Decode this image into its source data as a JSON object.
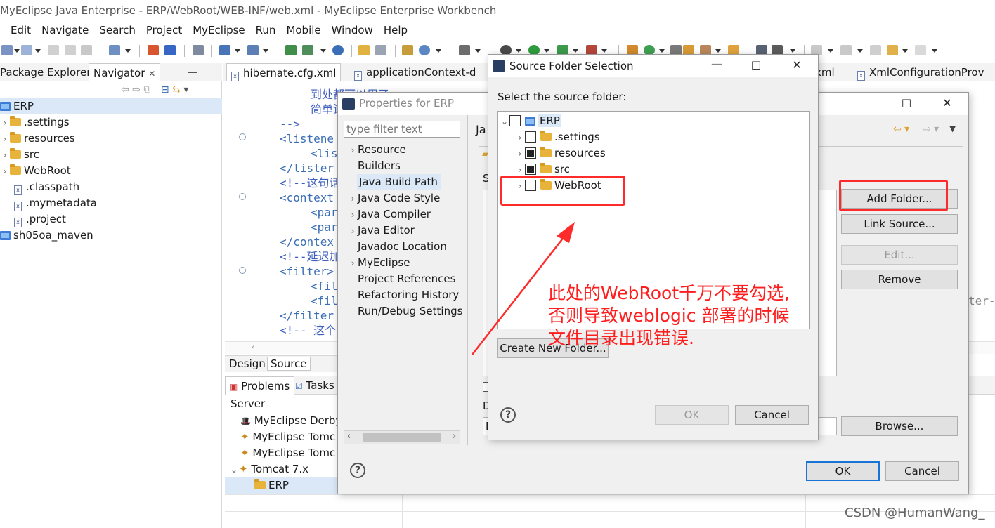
{
  "window": {
    "title": "MyEclipse Java Enterprise - ERP/WebRoot/WEB-INF/web.xml - MyEclipse Enterprise Workbench"
  },
  "menu": [
    "Edit",
    "Navigate",
    "Search",
    "Project",
    "MyEclipse",
    "Run",
    "Mobile",
    "Window",
    "Help"
  ],
  "left_panel": {
    "tabs": [
      "Package Explorer",
      "Navigator"
    ],
    "tree": [
      {
        "label": "ERP",
        "type": "project"
      },
      {
        "label": ".settings",
        "type": "folder"
      },
      {
        "label": "resources",
        "type": "folder"
      },
      {
        "label": "src",
        "type": "folder"
      },
      {
        "label": "WebRoot",
        "type": "folder"
      },
      {
        "label": ".classpath",
        "type": "file"
      },
      {
        "label": ".mymetadata",
        "type": "file"
      },
      {
        "label": ".project",
        "type": "file"
      },
      {
        "label": "sh05oa_maven",
        "type": "project"
      }
    ]
  },
  "editor": {
    "tabs": [
      "hibernate.cfg.xml",
      "applicationContext-d",
      "xml",
      "XmlConfigurationProv"
    ],
    "code_lines": [
      "到处都可以用了",
      "简单说",
      "-->",
      "<listene",
      "<lis",
      "</lister",
      "<!--这句话",
      "<context",
      "<par",
      "<par",
      "</contex",
      "<!--延迟加",
      "<filter>",
      "<fil",
      "<fil",
      "</filter",
      "<!-- 这个"
    ],
    "right_fragment": "ter-",
    "bottom_tabs": [
      "Design",
      "Source"
    ]
  },
  "bottom_panel": {
    "tabs": [
      "Problems",
      "Tasks"
    ],
    "header": "Server",
    "servers": [
      "MyEclipse Derby",
      "MyEclipse Tomc",
      "MyEclipse Tomc",
      "Tomcat  7.x",
      "ERP"
    ]
  },
  "properties_dialog": {
    "title": "Properties for ERP",
    "filter_placeholder": "type filter text",
    "nav_items": [
      "Resource",
      "Builders",
      "Java Build Path",
      "Java Code Style",
      "Java Compiler",
      "Java Editor",
      "Javadoc Location",
      "MyEclipse",
      "Project References",
      "Refactoring History",
      "Run/Debug Settings"
    ],
    "selected_item": "Java Build Path",
    "content_heading": "Ja",
    "buttons": {
      "add_folder": "Add Folder...",
      "link_source": "Link Source...",
      "edit": "Edit...",
      "remove": "Remove",
      "browse": "Browse...",
      "ok": "OK",
      "cancel": "Cancel"
    },
    "fragments": {
      "s": "S",
      "d": "D",
      "b": "B"
    }
  },
  "source_dialog": {
    "title": "Source Folder Selection",
    "prompt": "Select the source folder:",
    "tree": [
      {
        "label": "ERP",
        "state": "unchecked"
      },
      {
        "label": ".settings",
        "state": "unchecked"
      },
      {
        "label": "resources",
        "state": "partial"
      },
      {
        "label": "src",
        "state": "partial"
      },
      {
        "label": "WebRoot",
        "state": "unchecked"
      }
    ],
    "create_button": "Create New Folder...",
    "ok": "OK",
    "cancel": "Cancel"
  },
  "annotation": {
    "lines": [
      "此处的WebRoot千万不要勾选,",
      "否则导致weblogic 部署的时候",
      "文件目录出现错误."
    ],
    "color": "#ff1e1e"
  },
  "watermark": "CSDN @HumanWang_"
}
